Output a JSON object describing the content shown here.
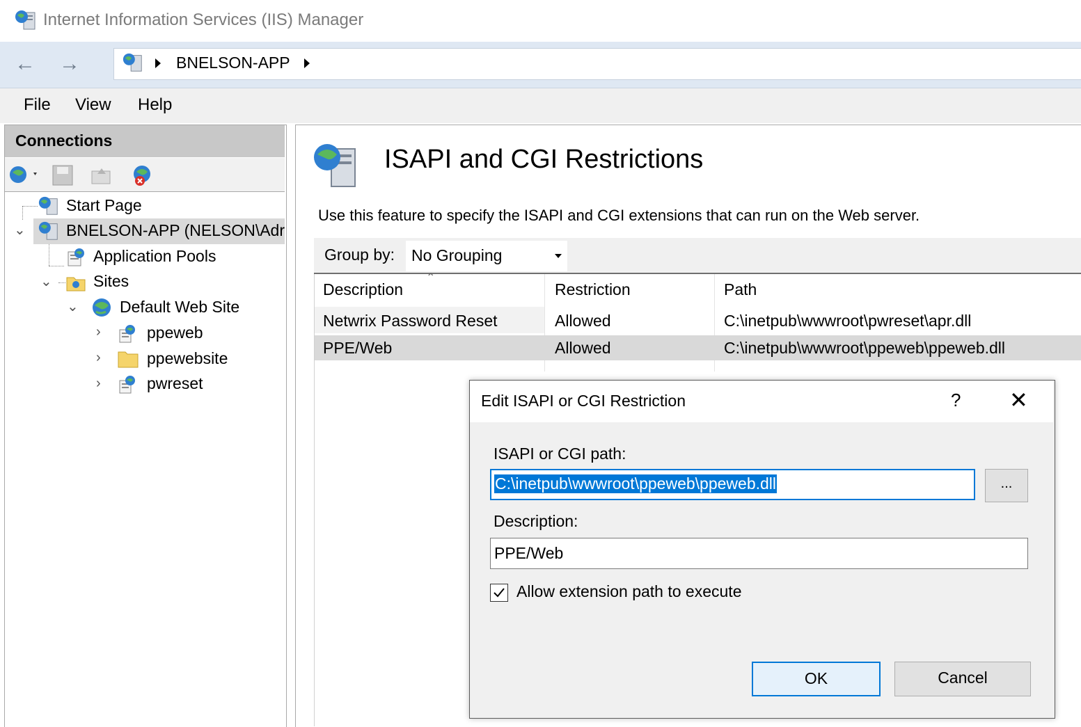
{
  "window": {
    "title": "Internet Information Services (IIS) Manager"
  },
  "addressbar": {
    "crumbs": [
      "BNELSON-APP"
    ]
  },
  "menu": {
    "file": "File",
    "view": "View",
    "help": "Help"
  },
  "connections": {
    "header": "Connections",
    "tree": {
      "start_page": "Start Page",
      "server": "BNELSON-APP (NELSON\\Adr",
      "app_pools": "Application Pools",
      "sites": "Sites",
      "default_site": "Default Web Site",
      "children": [
        "ppeweb",
        "ppewebsite",
        "pwreset"
      ]
    }
  },
  "feature": {
    "title": "ISAPI and CGI Restrictions",
    "description": "Use this feature to specify the ISAPI and CGI extensions that can run on the Web server.",
    "group_by_label": "Group by:",
    "group_by_value": "No Grouping",
    "columns": {
      "description": "Description",
      "restriction": "Restriction",
      "path": "Path"
    },
    "rows": [
      {
        "description": "Netwrix Password Reset",
        "restriction": "Allowed",
        "path": "C:\\inetpub\\wwwroot\\pwreset\\apr.dll"
      },
      {
        "description": "PPE/Web",
        "restriction": "Allowed",
        "path": "C:\\inetpub\\wwwroot\\ppeweb\\ppeweb.dll"
      }
    ]
  },
  "dialog": {
    "title": "Edit ISAPI or CGI Restriction",
    "help": "?",
    "close": "✕",
    "path_label": "ISAPI or CGI path:",
    "path_value": "C:\\inetpub\\wwwroot\\ppeweb\\ppeweb.dll",
    "browse_label": "...",
    "description_label": "Description:",
    "description_value": "PPE/Web",
    "allow_label": "Allow extension path to execute",
    "allow_checked": true,
    "ok_label": "OK",
    "cancel_label": "Cancel"
  },
  "icons": {
    "app": "iis-server-globe-icon",
    "back": "back-arrow-icon",
    "forward": "forward-arrow-icon",
    "feature": "iis-server-globe-icon"
  },
  "colors": {
    "accent": "#0078d7",
    "selection": "#d9d9d9",
    "header_gray": "#c8c8c8"
  }
}
